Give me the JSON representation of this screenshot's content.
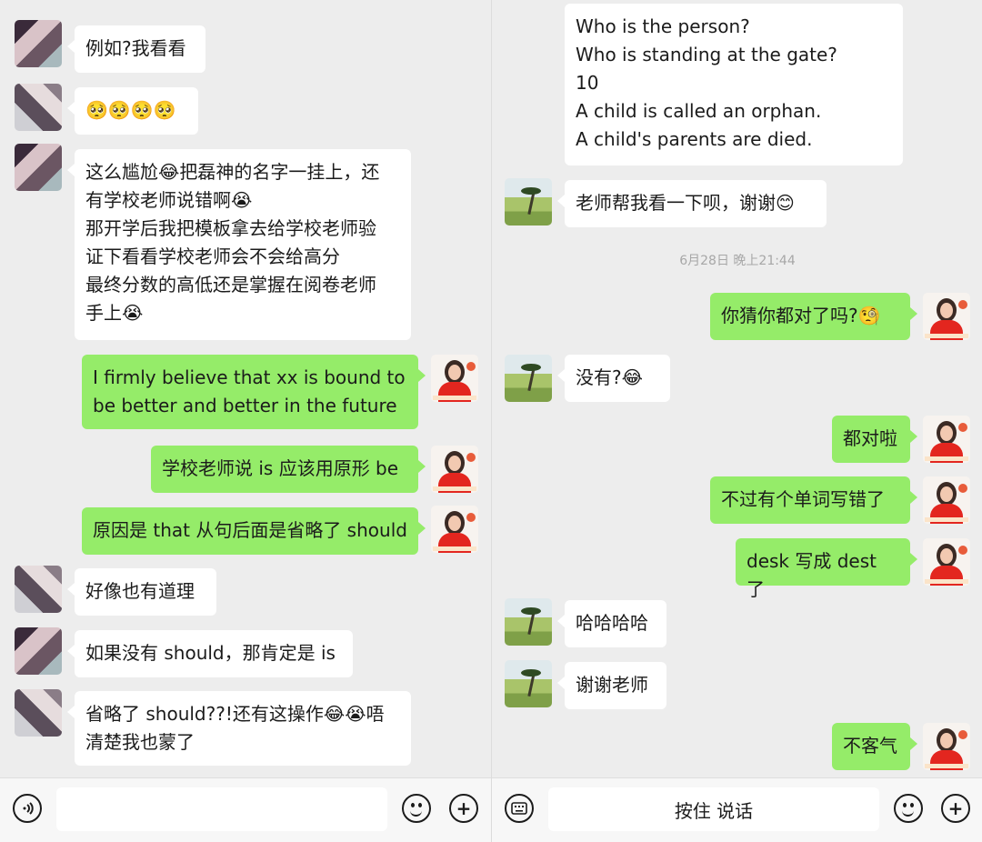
{
  "left_chat": {
    "messages": [
      {
        "side": "in",
        "text": "例如?我看看"
      },
      {
        "side": "in",
        "text": "🥺🥺🥺🥺"
      },
      {
        "side": "in",
        "text": "这么尴尬😂把磊神的名字一挂上，还\n有学校老师说错啊😭\n那开学后我把模板拿去给学校老师验\n证下看看学校老师会不会给高分\n最终分数的高低还是掌握在阅卷老师\n手上😭"
      },
      {
        "side": "out",
        "text": "I firmly believe that xx is bound to\nbe better and better in the future"
      },
      {
        "side": "out",
        "text": "学校老师说 is 应该用原形 be"
      },
      {
        "side": "out",
        "text": "原因是 that 从句后面是省略了 should"
      },
      {
        "side": "in",
        "text": "好像也有道理"
      },
      {
        "side": "in",
        "text": "如果没有 should，那肯定是 is"
      },
      {
        "side": "in",
        "text": "省略了 should??!还有这操作😂😭唔\n清楚我也蒙了"
      }
    ]
  },
  "right_chat": {
    "messages": [
      {
        "side": "in",
        "text": "Who is the person?\nWho is standing at the gate?\n10\nA child is called an orphan.\nA child's parents are died."
      },
      {
        "side": "in",
        "text": "老师帮我看一下呗，谢谢😊"
      },
      {
        "side": "out",
        "text": "你猜你都对了吗?🧐"
      },
      {
        "side": "in",
        "text": "没有?😂"
      },
      {
        "side": "out",
        "text": "都对啦"
      },
      {
        "side": "out",
        "text": "不过有个单词写错了"
      },
      {
        "side": "out",
        "text": "desk 写成 dest 了"
      },
      {
        "side": "in",
        "text": "哈哈哈哈"
      },
      {
        "side": "in",
        "text": "谢谢老师"
      },
      {
        "side": "out",
        "text": "不客气"
      }
    ],
    "timestamp": "6月28日 晚上21:44"
  },
  "left_input": {
    "voice_icon": "voice-icon",
    "emoji_icon": "emoji-icon",
    "plus_icon": "plus-icon"
  },
  "right_input": {
    "keyboard_icon": "keyboard-icon",
    "hold_to_talk": "按住 说话",
    "emoji_icon": "emoji-icon",
    "plus_icon": "plus-icon"
  },
  "colors": {
    "background": "#ededed",
    "incoming_bubble": "#ffffff",
    "outgoing_bubble": "#95ec69"
  }
}
